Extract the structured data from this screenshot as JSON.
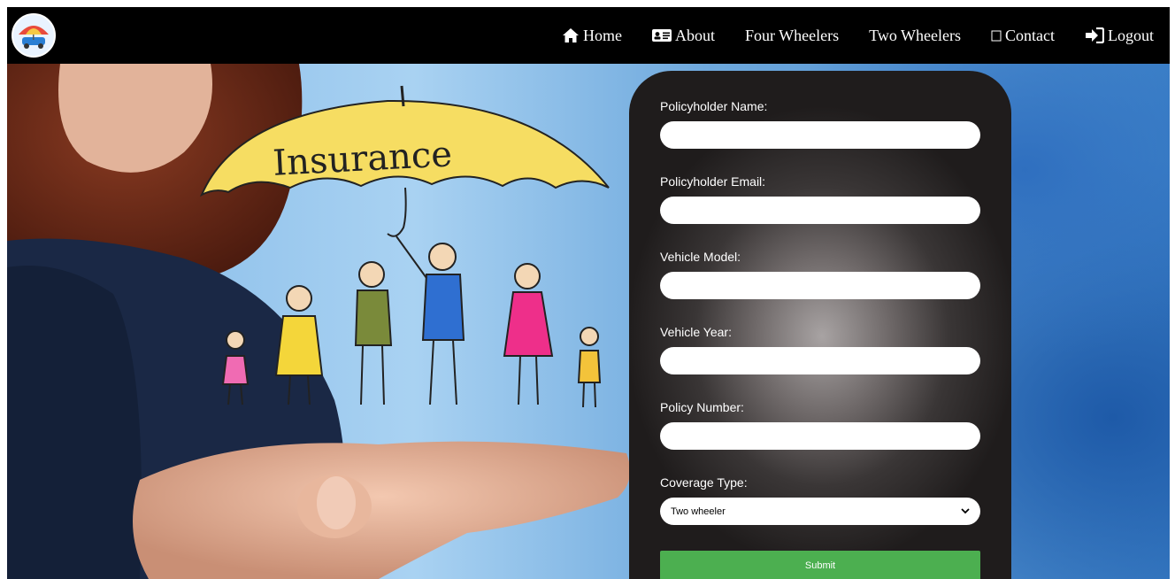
{
  "nav": {
    "items": [
      {
        "label": "Home",
        "icon": "home-icon"
      },
      {
        "label": "About",
        "icon": "id-card-icon"
      },
      {
        "label": "Four Wheelers",
        "icon": ""
      },
      {
        "label": "Two Wheelers",
        "icon": ""
      },
      {
        "label": "Contact",
        "icon": "box-icon"
      },
      {
        "label": "Logout",
        "icon": "logout-icon"
      }
    ]
  },
  "hero": {
    "umbrella_text": "Insurance"
  },
  "form": {
    "fields": [
      {
        "label": "Policyholder Name:",
        "value": ""
      },
      {
        "label": "Policyholder Email:",
        "value": ""
      },
      {
        "label": "Vehicle Model:",
        "value": ""
      },
      {
        "label": "Vehicle Year:",
        "value": ""
      },
      {
        "label": "Policy Number:",
        "value": ""
      }
    ],
    "coverage_label": "Coverage Type:",
    "coverage_selected": "Two wheeler",
    "submit_label": "Submit"
  },
  "colors": {
    "navbar": "#000000",
    "submit": "#4caf50",
    "umbrella": "#f6dd62"
  }
}
